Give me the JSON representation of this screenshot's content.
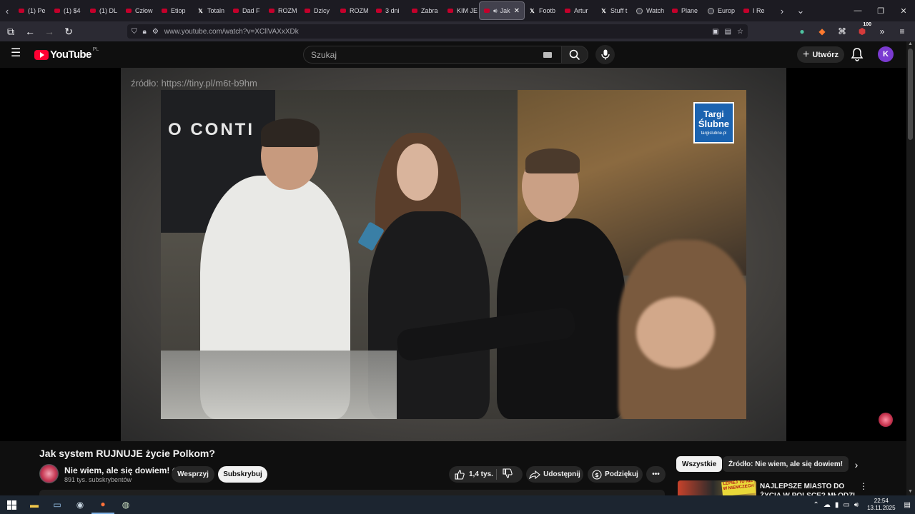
{
  "browser": {
    "tabs": [
      {
        "label": "(1) Pe",
        "icon": "youtube-icon"
      },
      {
        "label": "(1) $4",
        "icon": "youtube-icon"
      },
      {
        "label": "(1) DL",
        "icon": "youtube-icon"
      },
      {
        "label": "Człow",
        "icon": "youtube-icon"
      },
      {
        "label": "Etiop",
        "icon": "youtube-icon"
      },
      {
        "label": "Totaln",
        "icon": "x-icon"
      },
      {
        "label": "Dad F",
        "icon": "youtube-icon"
      },
      {
        "label": "ROZM",
        "icon": "youtube-icon"
      },
      {
        "label": "Dzicy",
        "icon": "youtube-icon"
      },
      {
        "label": "ROZM",
        "icon": "youtube-icon"
      },
      {
        "label": "3 dni",
        "icon": "youtube-icon"
      },
      {
        "label": "Zabra",
        "icon": "youtube-icon"
      },
      {
        "label": "KIM JE",
        "icon": "youtube-icon"
      },
      {
        "label": "Jak",
        "icon": "youtube-icon",
        "active": true
      },
      {
        "label": "Footb",
        "icon": "x-icon"
      },
      {
        "label": "Artur",
        "icon": "youtube-icon"
      },
      {
        "label": "Stuff t",
        "icon": "x-icon"
      },
      {
        "label": "Watch",
        "icon": "globe-icon"
      },
      {
        "label": "Plane",
        "icon": "youtube-icon"
      },
      {
        "label": "Europ",
        "icon": "globe-icon"
      },
      {
        "label": "I Re",
        "icon": "youtube-icon"
      }
    ],
    "url": "www.youtube.com/watch?v=XCllVAXxXDk",
    "extension_badge": "100"
  },
  "youtube": {
    "logo_text": "YouTube",
    "region": "PL",
    "search_placeholder": "Szukaj",
    "create_label": "Utwórz",
    "avatar_letter": "K"
  },
  "video": {
    "source_overlay": "źródło: https://tiny.pl/m6t-b9hm",
    "store_sign": "O CONTI",
    "brand_logo": {
      "line1": "Targi",
      "line2": "Ślubne",
      "line3": "targislubne.pl"
    },
    "title": "Jak system RUJNUJE życie Polkom?"
  },
  "channel": {
    "name": "Nie wiem, ale się dowiem!",
    "subscribers": "891 tys. subskrybentów",
    "support_label": "Wesprzyj",
    "subscribe_label": "Subskrybuj"
  },
  "actions": {
    "likes": "1,4 tys.",
    "share_label": "Udostępnij",
    "thanks_label": "Podziękuj"
  },
  "sidebar": {
    "chips": [
      "Wszystkie",
      "Źródło: Nie wiem, ale się dowiem!"
    ],
    "recommendation": {
      "title": "NAJLEPSZE MIASTO DO ŻYCIA W POLSCE? MŁODZI TU...",
      "thumb_text": "LEPIEJ TU NIŻ W NIEMCZECH"
    }
  },
  "taskbar": {
    "time": "22:54",
    "date": "13.11.2025"
  },
  "colors": {
    "yt_red": "#ff0033",
    "background": "#0f0f0f",
    "avatar": "#7b3bd1"
  }
}
